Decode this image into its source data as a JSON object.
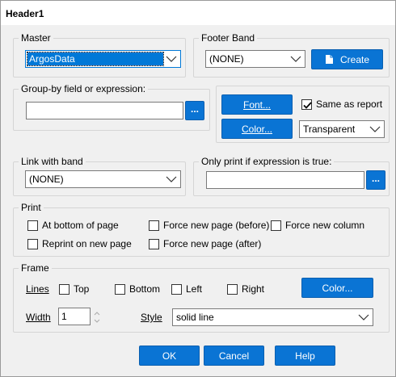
{
  "title": "Header1",
  "master": {
    "label": "Master",
    "value": "ArgosData"
  },
  "footer_band": {
    "label": "Footer Band",
    "value": "(NONE)",
    "create_label": "Create"
  },
  "group_by": {
    "label": "Group-by field or expression:",
    "value": "",
    "button_label": "..."
  },
  "font_button": "Font...",
  "same_as_report": {
    "label": "Same as report",
    "checked": true
  },
  "color_button": "Color...",
  "color_value": "Transparent",
  "link_band": {
    "label": "Link with band",
    "value": "(NONE)"
  },
  "only_print": {
    "label": "Only print if expression is true:",
    "value": "",
    "button_label": "..."
  },
  "print": {
    "label": "Print",
    "options": {
      "at_bottom": "At bottom of page",
      "force_before": "Force new page (before)",
      "force_column": "Force new column",
      "reprint": "Reprint on new page",
      "force_after": "Force new page (after)"
    }
  },
  "frame": {
    "label": "Frame",
    "lines_label": "Lines",
    "top": "Top",
    "bottom": "Bottom",
    "left": "Left",
    "right": "Right",
    "color_button": "Color...",
    "width_label": "Width",
    "width_value": "1",
    "style_label": "Style",
    "style_value": "solid line"
  },
  "buttons": {
    "ok": "OK",
    "cancel": "Cancel",
    "help": "Help"
  },
  "colors": {
    "accent": "#0a74d4",
    "selection": "#0078d7",
    "dialog_bg": "#f0f0f0"
  }
}
